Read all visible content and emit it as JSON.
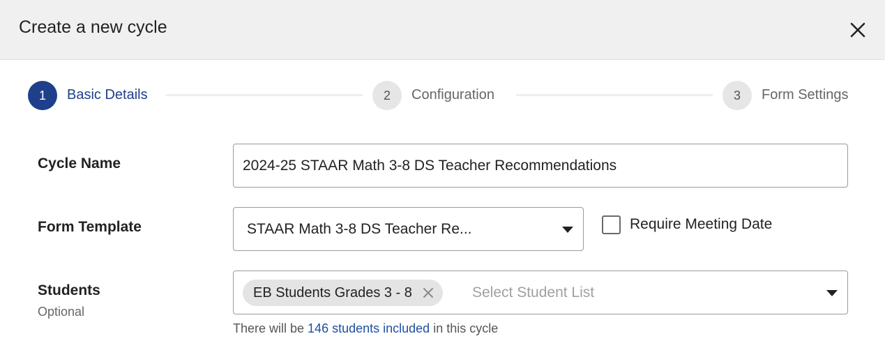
{
  "header": {
    "title": "Create a new cycle"
  },
  "stepper": {
    "steps": [
      {
        "number": "1",
        "label": "Basic Details"
      },
      {
        "number": "2",
        "label": "Configuration"
      },
      {
        "number": "3",
        "label": "Form Settings"
      }
    ],
    "active_step": 1
  },
  "form": {
    "cycle_name": {
      "label": "Cycle Name",
      "value": "2024-25 STAAR Math 3-8 DS Teacher Recommendations"
    },
    "form_template": {
      "label": "Form Template",
      "value": "STAAR Math 3-8 DS Teacher Re..."
    },
    "require_meeting_date": {
      "label": "Require Meeting Date",
      "checked": false
    },
    "students": {
      "label": "Students",
      "sublabel": "Optional",
      "selected_chip": "EB Students Grades 3 - 8",
      "placeholder": "Select Student List"
    },
    "info": {
      "prefix": "There will be ",
      "link": "146 students included",
      "suffix": " in this cycle"
    }
  },
  "colors": {
    "accent": "#1e3f8a",
    "link": "#1e4fa3",
    "header_bg": "#f0f0f0"
  },
  "icons": {
    "close": "close-icon",
    "dropdown": "caret-down-icon",
    "chip_remove": "x-icon"
  }
}
